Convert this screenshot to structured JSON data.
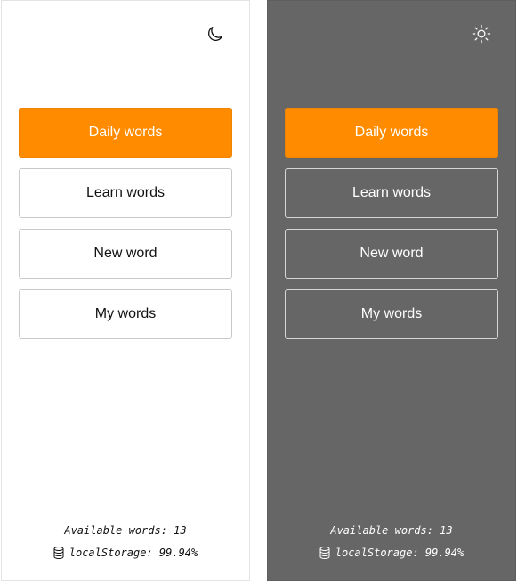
{
  "panels": [
    {
      "theme": "light",
      "theme_toggle_icon": "moon-icon",
      "menu": {
        "daily_words": "Daily words",
        "learn_words": "Learn words",
        "new_word": "New word",
        "my_words": "My words"
      },
      "footer": {
        "available_words": "Available words: 13",
        "local_storage": "localStorage: 99.94%",
        "storage_icon": "database-icon"
      }
    },
    {
      "theme": "dark",
      "theme_toggle_icon": "sun-icon",
      "menu": {
        "daily_words": "Daily words",
        "learn_words": "Learn words",
        "new_word": "New word",
        "my_words": "My words"
      },
      "footer": {
        "available_words": "Available words: 13",
        "local_storage": "localStorage: 99.94%",
        "storage_icon": "database-icon"
      }
    }
  ],
  "colors": {
    "accent": "#ff8c00",
    "light_bg": "#ffffff",
    "dark_bg": "#666666"
  }
}
